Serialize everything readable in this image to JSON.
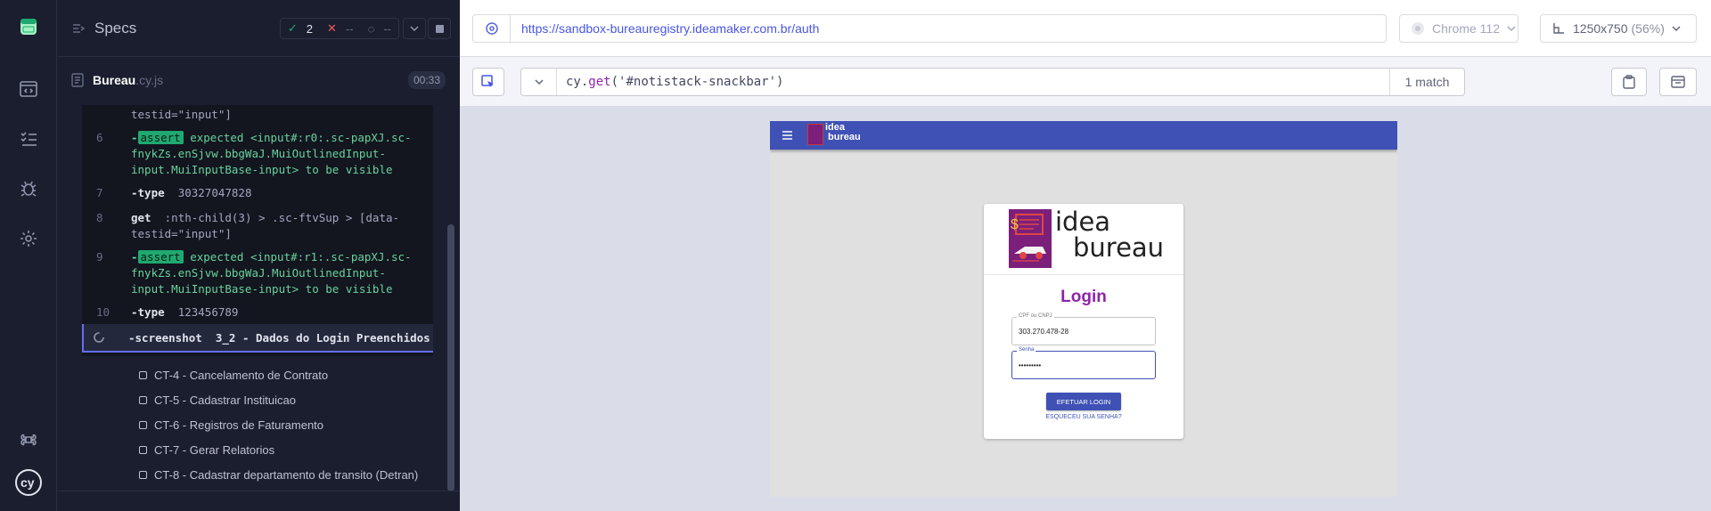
{
  "reporter": {
    "header_title": "Specs",
    "passed": "2",
    "failed": "--",
    "pending": "--",
    "spec_name": "Bureau",
    "spec_ext": ".cy.js",
    "duration": "00:33",
    "commands": [
      {
        "num": "",
        "name": "",
        "lines": [
          "testid=\"input\"]"
        ]
      },
      {
        "num": "6",
        "assert": "assert",
        "lines": [
          "expected <input#:r0:.sc-papXJ.sc-",
          "fnykZs.enSjvw.bbgWaJ.MuiOutlinedInput-",
          "input.MuiInputBase-input> to be visible"
        ]
      },
      {
        "num": "7",
        "name": "-type",
        "value": "30327047828"
      },
      {
        "num": "8",
        "name": "get",
        "lines": [
          ":nth-child(3) > .sc-ftvSup > [data-",
          "testid=\"input\"]"
        ]
      },
      {
        "num": "9",
        "assert": "assert",
        "lines": [
          "expected <input#:r1:.sc-papXJ.sc-",
          "fnykZs.enSjvw.bbgWaJ.MuiOutlinedInput-",
          "input.MuiInputBase-input> to be visible"
        ]
      },
      {
        "num": "10",
        "name": "-type",
        "value": "123456789"
      }
    ],
    "running": {
      "name": "-screenshot",
      "value": "3_2 - Dados do Login Preenchidos"
    },
    "tests": [
      "CT-4 - Cancelamento de Contrato",
      "CT-5 - Cadastrar Instituicao",
      "CT-6 - Registros de Faturamento",
      "CT-7 - Gerar Relatorios",
      "CT-8 - Cadastrar departamento de transito (Detran)"
    ]
  },
  "browser": {
    "url": "https://sandbox-bureauregistry.ideamaker.com.br/auth",
    "browser_name": "Chrome 112",
    "viewport": "1250x750",
    "viewport_scale": "(56%)",
    "selector_prefix": "cy.",
    "selector_method": "get",
    "selector_arg": "'#notistack-snackbar'",
    "match_count": "1 match"
  },
  "app": {
    "navbar_logo_top": "idea",
    "navbar_logo_bottom": "bureau",
    "card_logo_top": "idea",
    "card_logo_bottom": "bureau",
    "login_title": "Login",
    "cpf_label": "CPF ou CNPJ",
    "cpf_value": "303.270.478-28",
    "password_label": "Senha",
    "password_value": "•••••••••",
    "submit_label": "EFETUAR LOGIN",
    "forgot_label": "ESQUECEU SUA SENHA?"
  },
  "colors": {
    "accent": "#6470f3",
    "app_bar": "#3f51b5",
    "login_title": "#8e24aa",
    "pass": "#1fa971",
    "fail": "#f15a5a"
  }
}
